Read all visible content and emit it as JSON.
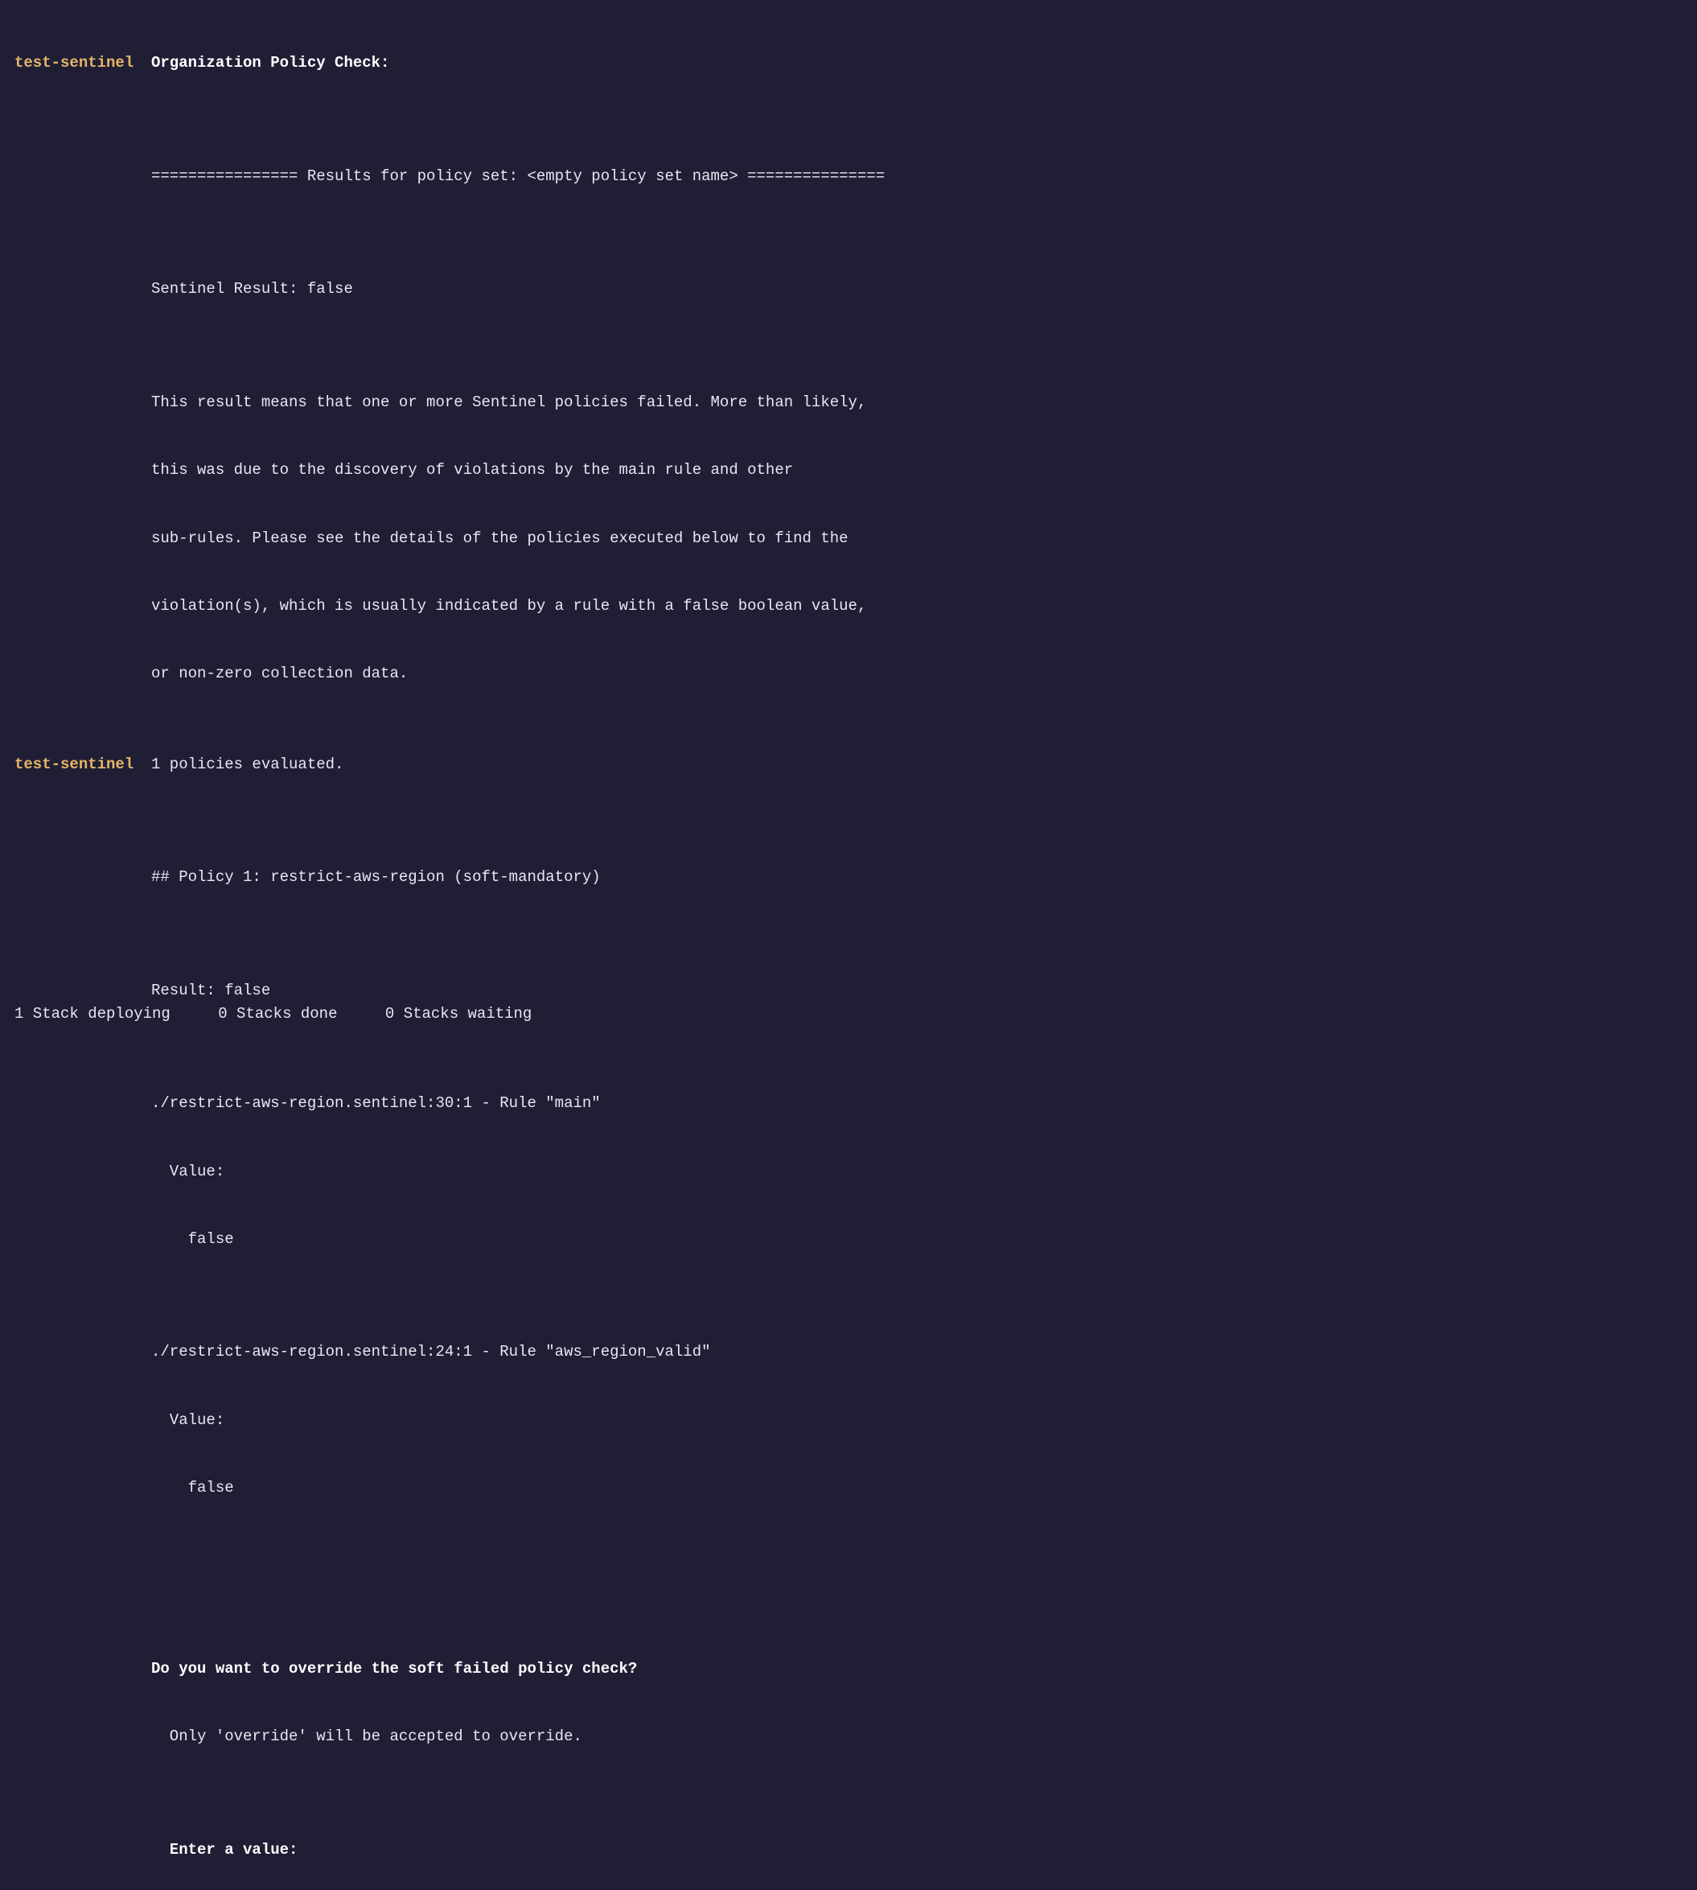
{
  "prefix": "test-sentinel",
  "block1": {
    "header": "Organization Policy Check:",
    "lines": [
      "",
      "================ Results for policy set: <empty policy set name> ===============",
      "",
      "Sentinel Result: false",
      "",
      "This result means that one or more Sentinel policies failed. More than likely,",
      "this was due to the discovery of violations by the main rule and other",
      "sub-rules. Please see the details of the policies executed below to find the",
      "violation(s), which is usually indicated by a rule with a false boolean value,",
      "or non-zero collection data."
    ]
  },
  "block2": {
    "header": "1 policies evaluated.",
    "lines": [
      "",
      "## Policy 1: restrict-aws-region (soft-mandatory)",
      "",
      "Result: false",
      "",
      "./restrict-aws-region.sentinel:30:1 - Rule \"main\"",
      "  Value:",
      "    false",
      "",
      "./restrict-aws-region.sentinel:24:1 - Rule \"aws_region_valid\"",
      "  Value:",
      "    false",
      "",
      ""
    ],
    "prompt_bold": "Do you want to override the soft failed policy check?",
    "prompt_hint": "  Only 'override' will be accepted to override.",
    "blank_after_hint": "",
    "enter_label": "  Enter a value: "
  },
  "status": {
    "deploying_count": "1",
    "deploying_label": " Stack deploying",
    "done_count": "0",
    "done_label": " Stacks done",
    "waiting_count": "0",
    "waiting_label": " Stacks waiting"
  }
}
